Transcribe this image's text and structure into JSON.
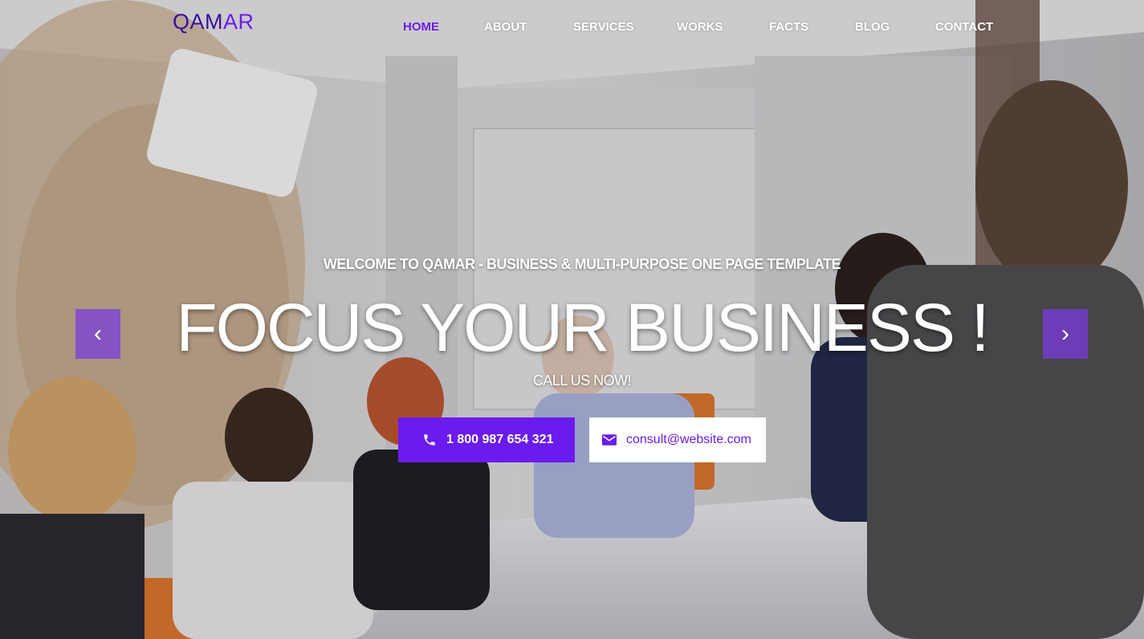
{
  "brand": {
    "part1": "QAM",
    "part2": "AR"
  },
  "nav": [
    "HOME",
    "ABOUT",
    "SERVICES",
    "WORKS",
    "FACTS",
    "BLOG",
    "CONTACT"
  ],
  "hero": {
    "subtitle": "WELCOME TO QAMAR - BUSINESS & MULTI-PURPOSE ONE PAGE TEMPLATE",
    "headline": "FOCUS YOUR BUSINESS !",
    "call": "CALL US NOW!",
    "phone": "1 800 987 654 321",
    "email": "consult@website.com",
    "prev": "‹",
    "next": "›"
  },
  "colors": {
    "accent": "#6a1cf0",
    "logo_dark": "#3b0f9a"
  },
  "icons": {
    "phone": "phone-icon",
    "mail": "mail-icon"
  }
}
